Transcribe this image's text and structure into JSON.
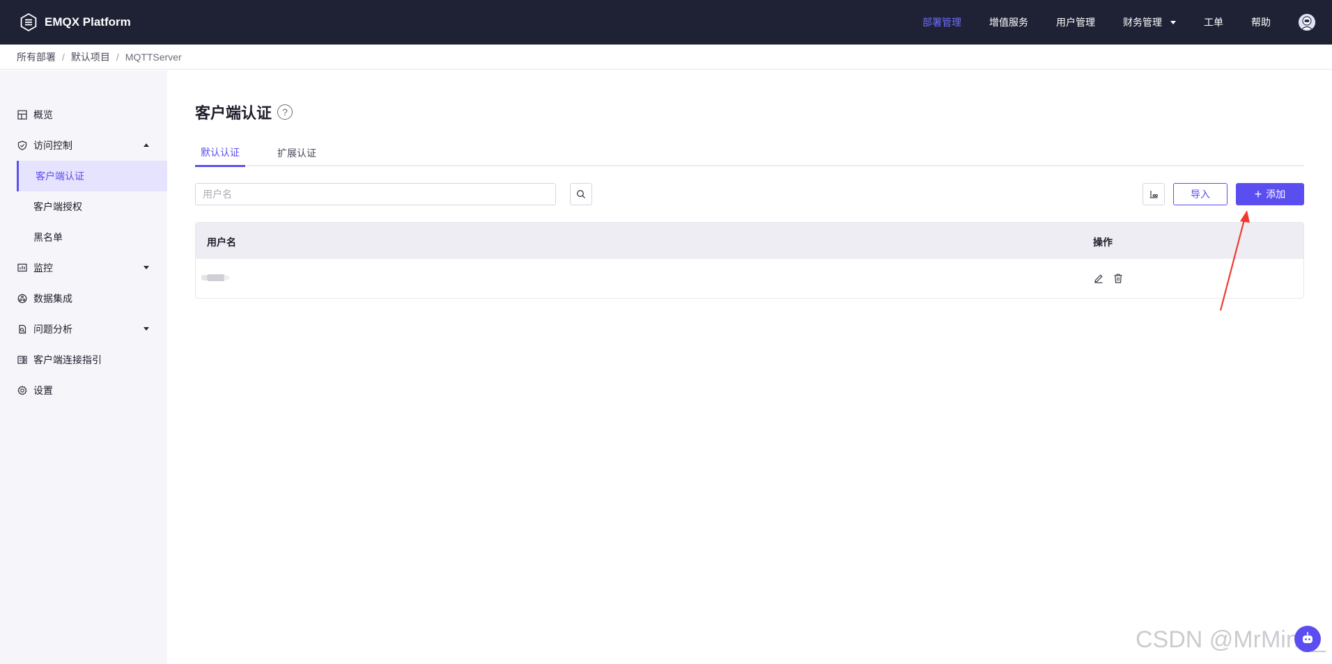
{
  "app": {
    "brand": "EMQX Platform",
    "accent_color": "#5b4ef0",
    "topbar_color": "#1f2235"
  },
  "topnav": {
    "items": [
      {
        "label": "部署管理",
        "active": true
      },
      {
        "label": "增值服务",
        "active": false
      },
      {
        "label": "用户管理",
        "active": false
      },
      {
        "label": "财务管理",
        "active": false,
        "dropdown": true
      },
      {
        "label": "工单",
        "active": false
      },
      {
        "label": "帮助",
        "active": false
      }
    ],
    "avatar_icon": "user-avatar-icon"
  },
  "breadcrumb": {
    "items": [
      "所有部署",
      "默认项目",
      "MQTTServer"
    ],
    "separator": "/"
  },
  "sidebar": {
    "items": [
      {
        "label": "概览",
        "icon": "overview-icon"
      },
      {
        "label": "访问控制",
        "icon": "shield-icon",
        "expanded": true
      },
      {
        "label": "客户端认证",
        "sub": true,
        "active": true
      },
      {
        "label": "客户端授权",
        "sub": true
      },
      {
        "label": "黑名单",
        "sub": true
      },
      {
        "label": "监控",
        "icon": "monitor-icon",
        "expanded": false
      },
      {
        "label": "数据集成",
        "icon": "data-integration-icon"
      },
      {
        "label": "问题分析",
        "icon": "diagnose-icon",
        "expanded": false
      },
      {
        "label": "客户端连接指引",
        "icon": "connect-guide-icon"
      },
      {
        "label": "设置",
        "icon": "gear-icon"
      }
    ]
  },
  "main": {
    "title": "客户端认证",
    "help_icon": "question-circle-icon",
    "tabs": [
      {
        "label": "默认认证",
        "active": true
      },
      {
        "label": "扩展认证",
        "active": false
      }
    ],
    "search": {
      "placeholder": "用户名",
      "value": ""
    },
    "import_label": "导入",
    "add_label": "添加",
    "table": {
      "columns": [
        "用户名",
        "操作"
      ],
      "rows": [
        {
          "username": "",
          "blurred": true,
          "actions": [
            "edit-icon",
            "delete-icon"
          ]
        }
      ]
    }
  },
  "watermark": "CSDN @MrMing_"
}
